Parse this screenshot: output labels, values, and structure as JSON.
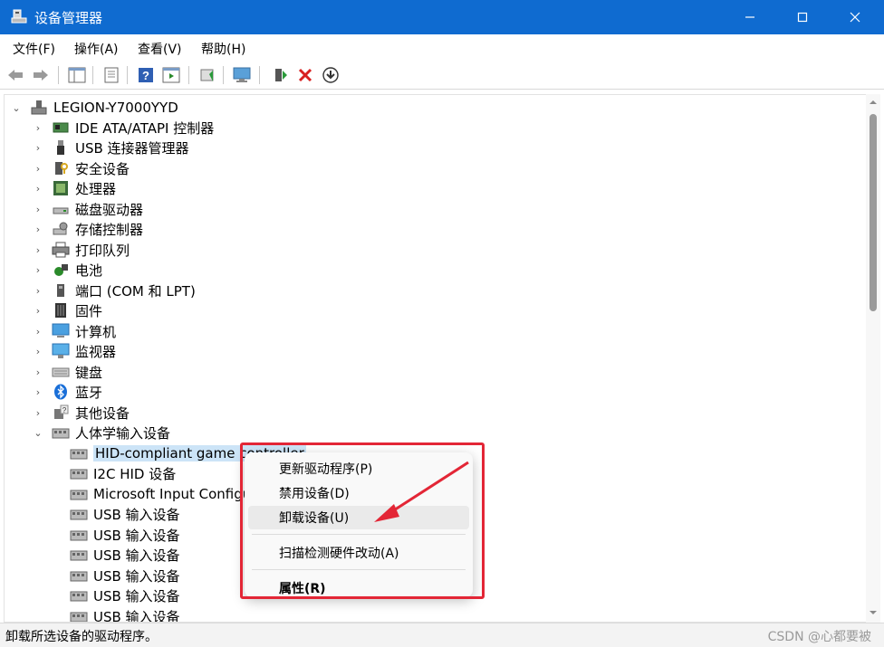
{
  "window": {
    "title": "设备管理器"
  },
  "menu": {
    "file": "文件(F)",
    "action": "操作(A)",
    "view": "查看(V)",
    "help": "帮助(H)"
  },
  "tree": {
    "root": "LEGION-Y7000YYD",
    "categories": [
      "IDE ATA/ATAPI 控制器",
      "USB 连接器管理器",
      "安全设备",
      "处理器",
      "磁盘驱动器",
      "存储控制器",
      "打印队列",
      "电池",
      "端口 (COM 和 LPT)",
      "固件",
      "计算机",
      "监视器",
      "键盘",
      "蓝牙",
      "其他设备",
      "人体学输入设备"
    ],
    "hid_children": [
      "HID-compliant game controller",
      "I2C HID 设备",
      "Microsoft Input Configu",
      "USB 输入设备",
      "USB 输入设备",
      "USB 输入设备",
      "USB 输入设备",
      "USB 输入设备",
      "USB 输入设备"
    ]
  },
  "context_menu": {
    "update_driver": "更新驱动程序(P)",
    "disable": "禁用设备(D)",
    "uninstall": "卸载设备(U)",
    "scan": "扫描检测硬件改动(A)",
    "properties": "属性(R)"
  },
  "status": {
    "text": "卸载所选设备的驱动程序。"
  },
  "watermark": "CSDN @心都要被",
  "colors": {
    "titlebar": "#0f6bd0",
    "highlight_box": "#e32636",
    "selection": "#cce4f7"
  }
}
